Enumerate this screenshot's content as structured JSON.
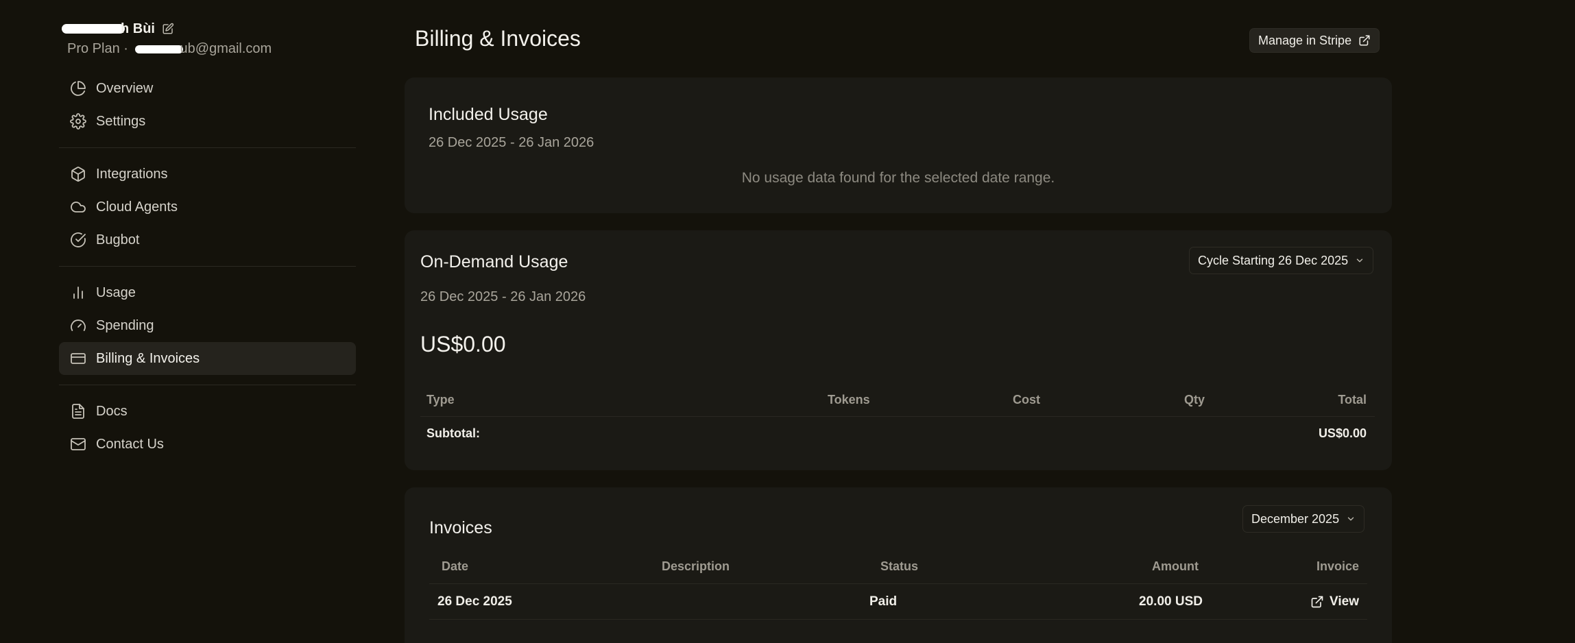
{
  "user": {
    "name_suffix": "h Bùi",
    "plan": "Pro Plan",
    "separator": "·",
    "email_suffix": "ub@gmail.com"
  },
  "sidebar": {
    "groups": [
      [
        {
          "label": "Overview",
          "icon": "pie-chart-icon"
        },
        {
          "label": "Settings",
          "icon": "gear-icon"
        }
      ],
      [
        {
          "label": "Integrations",
          "icon": "box-icon"
        },
        {
          "label": "Cloud Agents",
          "icon": "cloud-icon"
        },
        {
          "label": "Bugbot",
          "icon": "check-circle-icon"
        }
      ],
      [
        {
          "label": "Usage",
          "icon": "bar-chart-icon"
        },
        {
          "label": "Spending",
          "icon": "gauge-icon"
        },
        {
          "label": "Billing & Invoices",
          "icon": "credit-card-icon",
          "active": true
        }
      ],
      [
        {
          "label": "Docs",
          "icon": "document-icon"
        },
        {
          "label": "Contact Us",
          "icon": "mail-icon"
        }
      ]
    ]
  },
  "header": {
    "title": "Billing & Invoices",
    "stripe_button": "Manage in Stripe"
  },
  "included_usage": {
    "title": "Included Usage",
    "range": "26 Dec 2025 - 26 Jan 2026",
    "empty": "No usage data found for the selected date range."
  },
  "on_demand": {
    "title": "On-Demand Usage",
    "cycle_select": "Cycle Starting 26 Dec 2025",
    "range": "26 Dec 2025 - 26 Jan 2026",
    "amount": "US$0.00",
    "columns": {
      "type": "Type",
      "tokens": "Tokens",
      "cost": "Cost",
      "qty": "Qty",
      "total": "Total"
    },
    "subtotal_label": "Subtotal:",
    "subtotal_value": "US$0.00"
  },
  "invoices": {
    "title": "Invoices",
    "month_select": "December 2025",
    "columns": {
      "date": "Date",
      "description": "Description",
      "status": "Status",
      "amount": "Amount",
      "invoice": "Invoice"
    },
    "rows": [
      {
        "date": "26 Dec 2025",
        "description": "",
        "status": "Paid",
        "amount": "20.00 USD",
        "link": "View"
      }
    ]
  },
  "colors": {
    "background": "#14120b",
    "card": "#1b1a15",
    "active_nav": "#25231d"
  }
}
